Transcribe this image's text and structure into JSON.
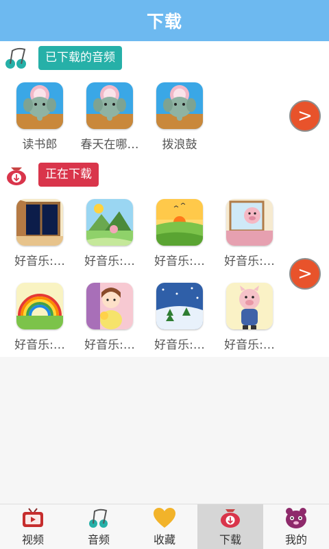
{
  "header": {
    "title": "下载"
  },
  "downloaded": {
    "title": "已下载的音频",
    "items": [
      {
        "label": "读书郎"
      },
      {
        "label": "春天在哪…"
      },
      {
        "label": "拨浪鼓"
      }
    ]
  },
  "downloading": {
    "title": "正在下载",
    "items": [
      {
        "label": "好音乐:…"
      },
      {
        "label": "好音乐:…"
      },
      {
        "label": "好音乐:…"
      },
      {
        "label": "好音乐:…"
      },
      {
        "label": "好音乐:…"
      },
      {
        "label": "好音乐:…"
      },
      {
        "label": "好音乐:…"
      },
      {
        "label": "好音乐:…"
      }
    ]
  },
  "next_label": ">",
  "tabs": [
    {
      "label": "视频",
      "icon": "tv-icon"
    },
    {
      "label": "音频",
      "icon": "music-note-icon"
    },
    {
      "label": "收藏",
      "icon": "heart-icon"
    },
    {
      "label": "下载",
      "icon": "download-bag-icon",
      "active": true
    },
    {
      "label": "我的",
      "icon": "bear-face-icon"
    }
  ],
  "colors": {
    "header": "#6db9f0",
    "teal": "#26b0a8",
    "red": "#d9354b",
    "arrow": "#e8532b"
  }
}
